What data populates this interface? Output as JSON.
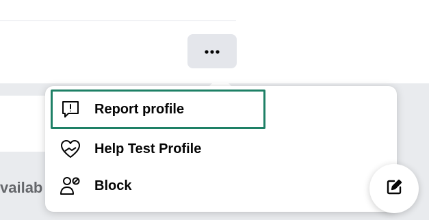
{
  "menu": {
    "items": [
      {
        "label": "Report profile",
        "icon": "report-icon"
      },
      {
        "label": "Help Test Profile",
        "icon": "heart-icon"
      },
      {
        "label": "Block",
        "icon": "block-user-icon"
      }
    ]
  },
  "background": {
    "partial_text": "vailab"
  },
  "colors": {
    "highlight": "#1e8066",
    "button_bg": "#e4e6eb",
    "page_gray": "#e9ebee",
    "text": "#050505"
  },
  "icons": {
    "more_button": "more-horizontal-icon",
    "fab": "compose-icon"
  }
}
